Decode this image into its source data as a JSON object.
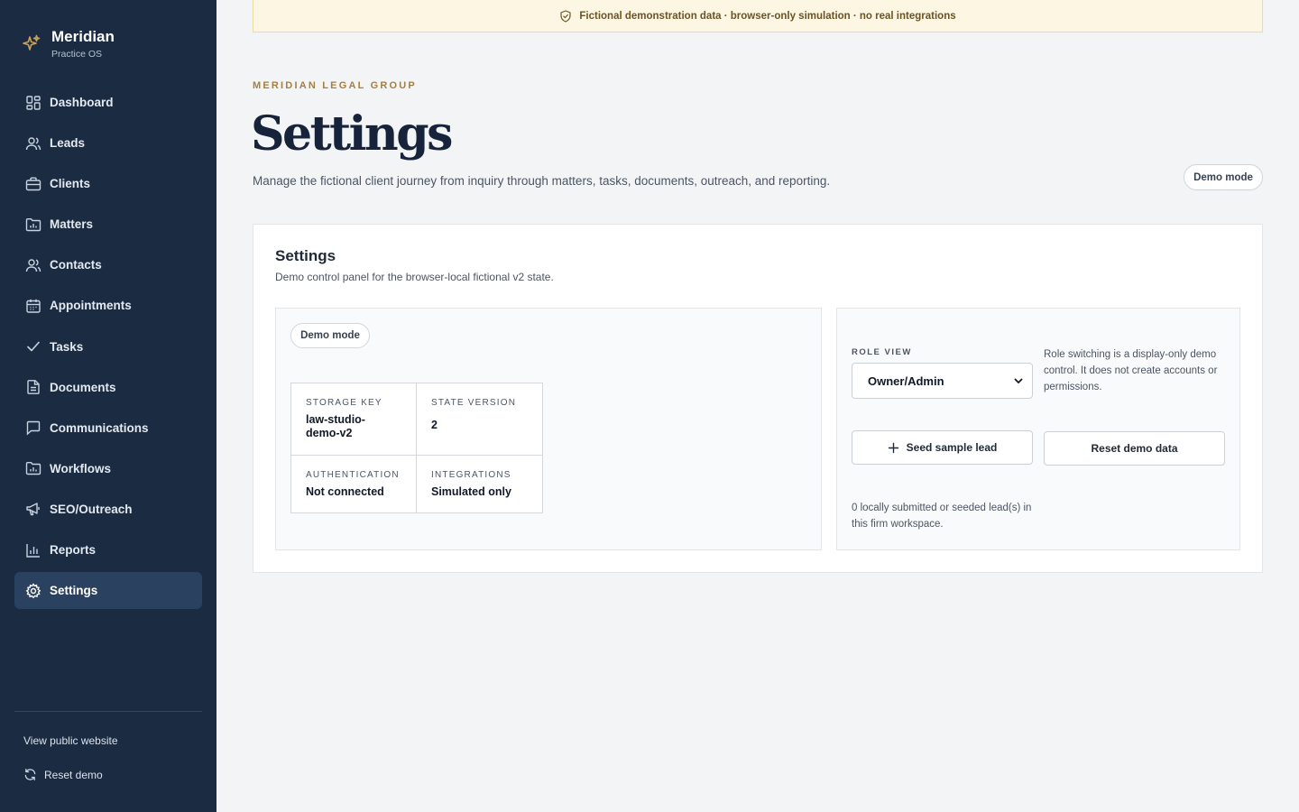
{
  "brand": {
    "name": "Meridian",
    "subtitle": "Practice OS"
  },
  "nav": {
    "items": [
      {
        "label": "Dashboard",
        "icon": "dashboard-icon"
      },
      {
        "label": "Leads",
        "icon": "users-icon"
      },
      {
        "label": "Clients",
        "icon": "briefcase-icon"
      },
      {
        "label": "Matters",
        "icon": "folder-chart-icon"
      },
      {
        "label": "Contacts",
        "icon": "users-icon"
      },
      {
        "label": "Appointments",
        "icon": "calendar-icon"
      },
      {
        "label": "Tasks",
        "icon": "check-icon"
      },
      {
        "label": "Documents",
        "icon": "document-icon"
      },
      {
        "label": "Communications",
        "icon": "message-icon"
      },
      {
        "label": "Workflows",
        "icon": "folder-chart-icon"
      },
      {
        "label": "SEO/Outreach",
        "icon": "megaphone-icon"
      },
      {
        "label": "Reports",
        "icon": "bar-chart-icon"
      },
      {
        "label": "Settings",
        "icon": "gear-icon",
        "active": true
      }
    ],
    "view_public": "View public website",
    "reset_demo": "Reset demo"
  },
  "banner": {
    "text": "Fictional demonstration data · browser-only simulation · no real integrations"
  },
  "header": {
    "eyebrow": "MERIDIAN LEGAL GROUP",
    "title": "Settings",
    "description": "Manage the fictional client journey from inquiry through matters, tasks, documents, outreach, and reporting.",
    "mode_pill": "Demo mode"
  },
  "card": {
    "title": "Settings",
    "subtitle": "Demo control panel for the browser-local fictional v2 state.",
    "left": {
      "mode_pill": "Demo mode",
      "stats": [
        {
          "label": "STORAGE KEY",
          "value": "law-studio-demo-v2"
        },
        {
          "label": "STATE VERSION",
          "value": "2"
        },
        {
          "label": "AUTHENTICATION",
          "value": "Not connected"
        },
        {
          "label": "INTEGRATIONS",
          "value": "Simulated only"
        }
      ]
    },
    "right": {
      "role_label": "ROLE VIEW",
      "role_value": "Owner/Admin",
      "role_note": "Role switching is a display-only demo control. It does not create accounts or permissions.",
      "seed_button": "Seed sample lead",
      "reset_button": "Reset demo data",
      "lead_count_text": "0 locally submitted or seeded lead(s) in this firm workspace."
    }
  },
  "colors": {
    "sidebar_bg": "#1a2b42",
    "sidebar_active": "#2a4260",
    "accent_gold": "#a77f3c",
    "banner_bg": "#fdf6e3"
  }
}
